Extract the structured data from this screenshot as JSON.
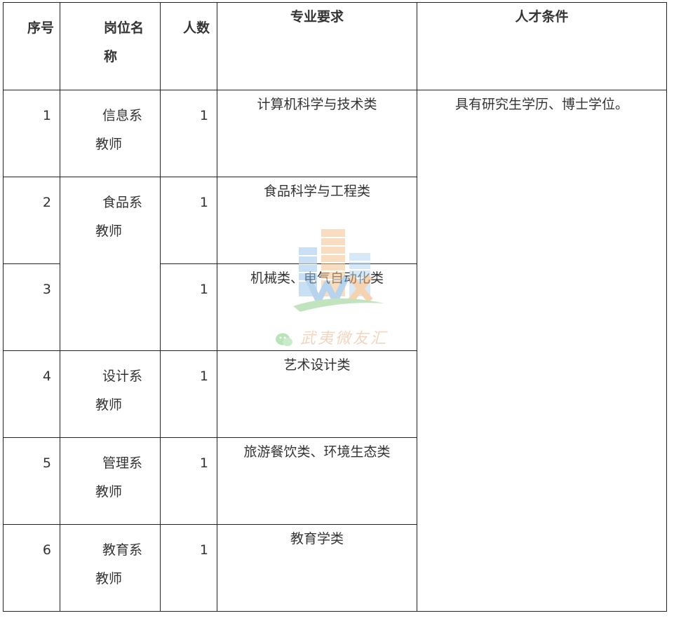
{
  "headers": {
    "seq": "序号",
    "post": "岗位名称",
    "count": "人数",
    "major": "专业要求",
    "condition": "人才条件"
  },
  "rows": [
    {
      "seq": "1",
      "post": "信息系教师",
      "count": "1",
      "major": "计算机科学与技术类"
    },
    {
      "seq": "2",
      "post": "食品系教师",
      "count": "1",
      "major": "食品科学与工程类"
    },
    {
      "seq": "3",
      "count": "1",
      "major": "机械类、电气自动化类"
    },
    {
      "seq": "4",
      "post": "设计系教师",
      "count": "1",
      "major": "艺术设计类"
    },
    {
      "seq": "5",
      "post": "管理系教师",
      "count": "1",
      "major": "旅游餐饮类、环境生态类"
    },
    {
      "seq": "6",
      "post": "教育系教师",
      "count": "1",
      "major": "教育学类"
    }
  ],
  "condition_text": "具有研究生学历、博士学位。",
  "watermark": {
    "text": "武夷微友汇",
    "icon": "wechat-icon",
    "logo": "wyx-building-logo"
  }
}
